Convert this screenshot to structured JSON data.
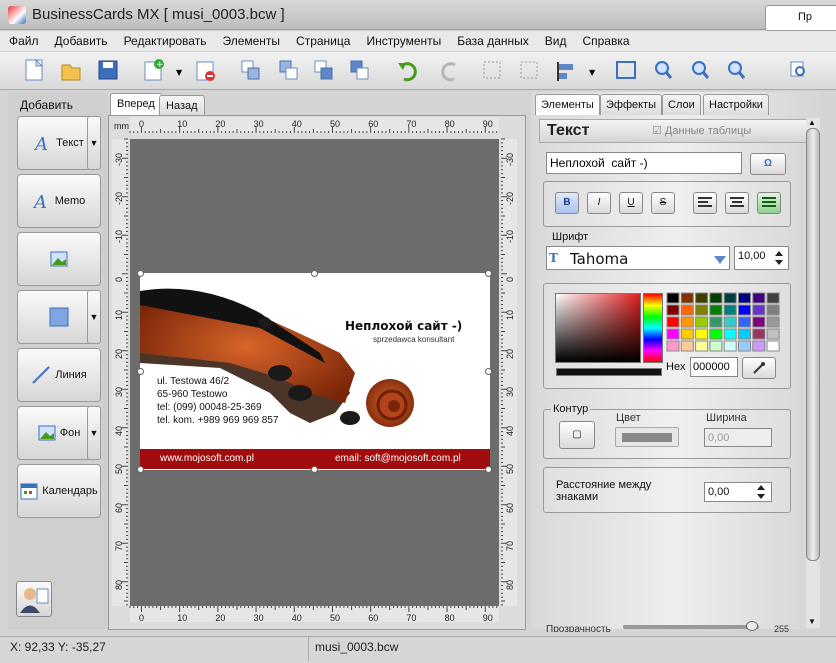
{
  "window": {
    "title": "BusinessCards MX [ musi_0003.bcw ]",
    "minimize": "_",
    "maximize": "□",
    "close": "✕"
  },
  "menu": [
    "Файл",
    "Добавить",
    "Редактировать",
    "Элементы",
    "Страница",
    "Инструменты",
    "База данных",
    "Вид",
    "Справка"
  ],
  "toolbar": {
    "print_label": "Пр"
  },
  "left_panel": {
    "title": "Добавить",
    "buttons": [
      {
        "label": "Текст",
        "icon": "text-icon"
      },
      {
        "label": "Memo",
        "icon": "memo-icon"
      },
      {
        "label": "",
        "icon": "image-icon"
      },
      {
        "label": "",
        "icon": "rectangle-icon"
      },
      {
        "label": "Линия",
        "icon": "line-icon"
      },
      {
        "label": "Фон",
        "icon": "background-icon"
      },
      {
        "label": "Календарь",
        "icon": "calendar-icon"
      }
    ]
  },
  "center": {
    "tabs": [
      "Вперед",
      "Назад"
    ],
    "ruler_unit": "mm",
    "ruler_h": [
      "0",
      "10",
      "20",
      "30",
      "40",
      "50",
      "60",
      "70",
      "80",
      "90"
    ],
    "ruler_v": [
      "-30",
      "-20",
      "-10",
      "0",
      "10",
      "20",
      "30",
      "40",
      "50",
      "60",
      "70",
      "80"
    ],
    "ruler_v_right": [
      "-30",
      "-20",
      "-10",
      "0",
      "10",
      "20",
      "30",
      "40",
      "50",
      "60",
      "70",
      "80"
    ]
  },
  "card": {
    "headline": "Неплохой  сайт -)",
    "subheadline": "sprzedawca konsultant",
    "address1": "ul. Testowa 46/2",
    "address2": "65-960 Testowo",
    "phone": "tel: (099) 00048-25-369",
    "mobile": "tel. kom. +989 969 969 857",
    "website": "www.mojosoft.com.pl",
    "email": "email: soft@mojosoft.com.pl",
    "colors": {
      "footer": "#a10d0d",
      "violin": "#b5431a"
    }
  },
  "right_panel": {
    "tabs": [
      "Элементы",
      "Эффекты",
      "Слои",
      "Настройки"
    ],
    "element_title": "Текст",
    "data_table_label": "Данные таблицы",
    "text_value": "Неплохой  сайт -)",
    "omega_button": "Ω",
    "format_buttons": [
      "B",
      "I",
      "U",
      "S"
    ],
    "font_label": "Шрифт",
    "font_name": "Tahoma",
    "font_size": "10,00",
    "hex_label": "Hex",
    "hex_value": "000000",
    "outline_label": "Контур",
    "color_label": "Цвет",
    "width_label": "Ширина",
    "width_value": "0,00",
    "spacing_label": "Расстояние между знаками",
    "spacing_value": "0,00",
    "opacity_label": "Прозрачность",
    "opacity_value": "255"
  },
  "status": {
    "coords": "X: 92,33 Y: -35,27",
    "file": "musi_0003.bcw"
  }
}
